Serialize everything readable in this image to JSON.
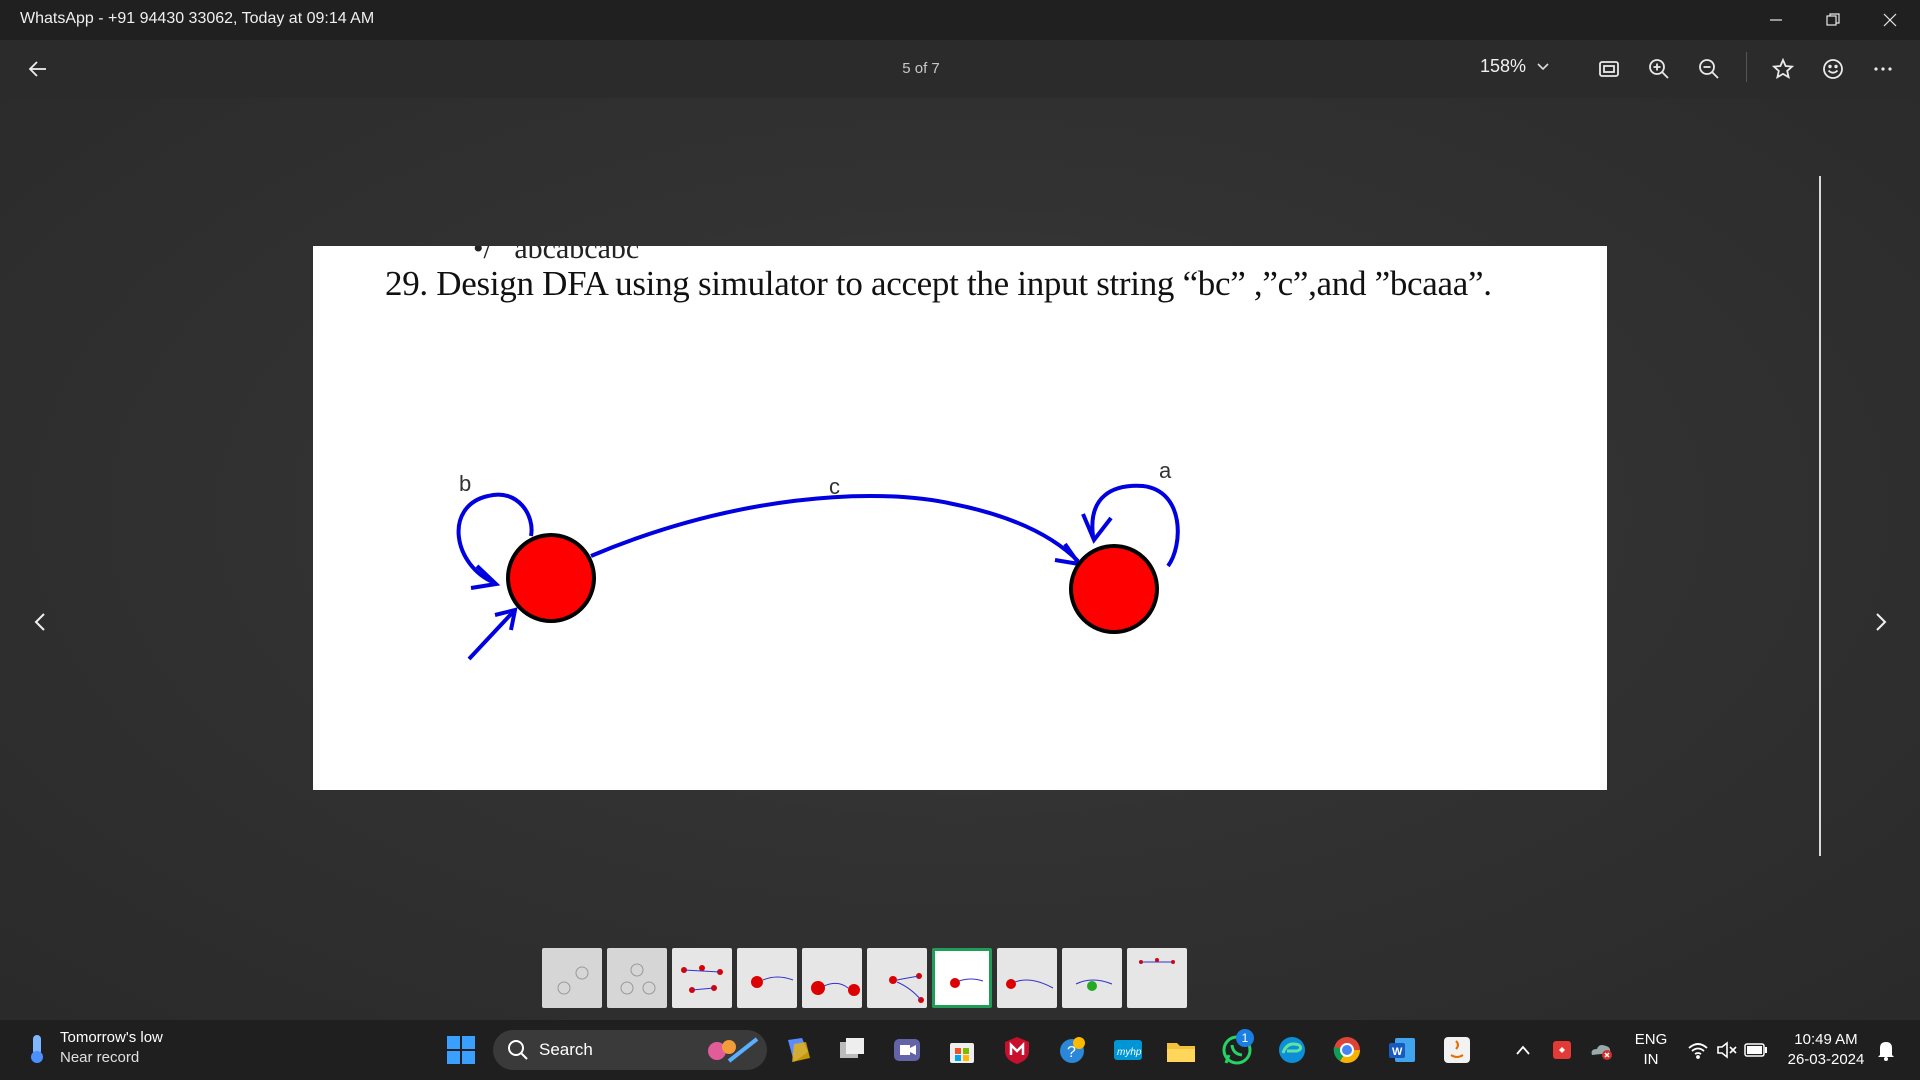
{
  "window": {
    "title": "WhatsApp - +91 94430 33062, Today at 09:14 AM"
  },
  "toolbar": {
    "page_indicator": "5 of 7",
    "zoom_level": "158%"
  },
  "document": {
    "question": "29.  Design DFA  using simulator to accept the input string “bc” ,”c”,and ”bcaaa”.",
    "cutoff_text": "•/   abcabcabc",
    "diagram_labels": {
      "loop_start": "b",
      "transition": "c",
      "loop_end": "a"
    },
    "colors": {
      "state_fill": "#ff0000",
      "edge": "#0000e0"
    }
  },
  "thumbnails": {
    "count": 10,
    "active_index": 6
  },
  "taskbar": {
    "weather_title": "Tomorrow's low",
    "weather_sub": "Near record",
    "search_label": "Search",
    "whatsapp_badge": "1",
    "lang_top": "ENG",
    "lang_bottom": "IN",
    "time": "10:49 AM",
    "date": "26-03-2024"
  }
}
